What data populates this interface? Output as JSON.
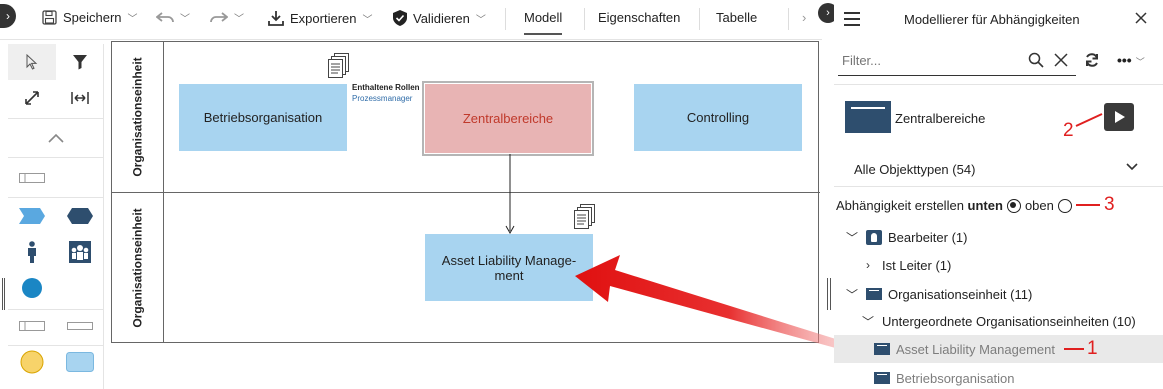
{
  "toolbar": {
    "save": "Speichern",
    "export": "Exportieren",
    "validate": "Validieren",
    "tabs": [
      "Modell",
      "Eigenschaften",
      "Tabelle"
    ]
  },
  "palette": {
    "icons": [
      "pointer-icon",
      "filter-icon",
      "resize-icon",
      "fit-width-icon",
      "collapse-up-icon",
      "lane-shape-icon",
      "event-shape-icon",
      "process-shape-icon",
      "person-shape-icon",
      "group-shape-icon",
      "circle-shape-icon",
      "lane-outline-icon",
      "bar-shape-icon",
      "yellow-circle-icon",
      "rounded-box-icon"
    ]
  },
  "canvas": {
    "lanes": [
      "Organisationseinheit",
      "Organisationseinheit"
    ],
    "nodes": {
      "betriebsorganisation": "Betriebsorganisation",
      "zentralbereiche": "Zentralbereiche",
      "controlling": "Controlling",
      "asset_liability": "Asset Liability Manage-\nment"
    },
    "roles": {
      "heading": "Enthaltene Rollen",
      "role": "Prozessmanager"
    }
  },
  "panel": {
    "title": "Modellierer für Abhängigkeiten",
    "filter_placeholder": "Filter...",
    "selected": "Zentralbereiche",
    "type_select": "Alle Objekttypen (54)",
    "dependency_label": "Abhängigkeit erstellen",
    "dependency_bold": "unten",
    "dependency_option_top": "oben",
    "tree": [
      {
        "label": "Bearbeiter (1)",
        "icon": "person-icon",
        "expanded": true
      },
      {
        "label": "Ist Leiter (1)",
        "expanded": false
      },
      {
        "label": "Organisationseinheit (11)",
        "icon": "org-unit-icon",
        "expanded": true
      },
      {
        "label": "Untergeordnete Organisationseinheiten (10)",
        "expanded": true
      },
      {
        "label": "Asset Liability Management",
        "icon": "org-unit-icon",
        "highlighted": true
      },
      {
        "label": "Betriebsorganisation",
        "icon": "org-unit-icon"
      }
    ]
  },
  "annotations": {
    "one": "1",
    "two": "2",
    "three": "3"
  },
  "colors": {
    "node_blue": "#a8d4f0",
    "node_selected": "#e8b4b4",
    "selected_text": "#c0392b",
    "annotation_red": "#e02020",
    "org_icon": "#2e4e6e"
  }
}
